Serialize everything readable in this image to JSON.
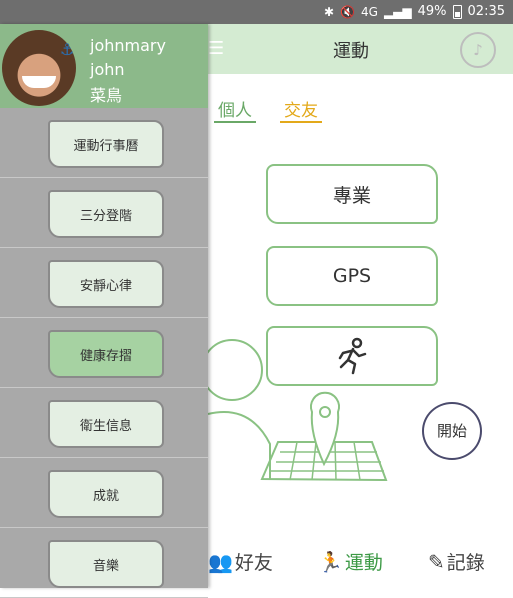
{
  "statusbar": {
    "network": "4G",
    "battery_text": "49%",
    "time": "02:35"
  },
  "appbar": {
    "title": "運動",
    "menu_icon": "hamburger-icon",
    "logo_icon": "app-logo-icon"
  },
  "tabs": {
    "personal": "個人",
    "friends": "交友"
  },
  "modes": {
    "professional": "專業",
    "gps": "GPS",
    "run_icon": "runner-icon"
  },
  "start_button": "開始",
  "bottom_nav": {
    "friends": "好友",
    "sport": "運動",
    "record": "記錄"
  },
  "drawer": {
    "username": "johnmary",
    "nickname": "john",
    "level": "菜鳥",
    "items": [
      {
        "label": "運動行事曆"
      },
      {
        "label": "三分登階"
      },
      {
        "label": "安靜心律"
      },
      {
        "label": "健康存摺"
      },
      {
        "label": "衛生信息"
      },
      {
        "label": "成就"
      },
      {
        "label": "音樂"
      }
    ]
  },
  "colors": {
    "accent_green": "#6aa867",
    "accent_yellow": "#e3a91a",
    "drawer_bg": "#a9a9a9"
  }
}
